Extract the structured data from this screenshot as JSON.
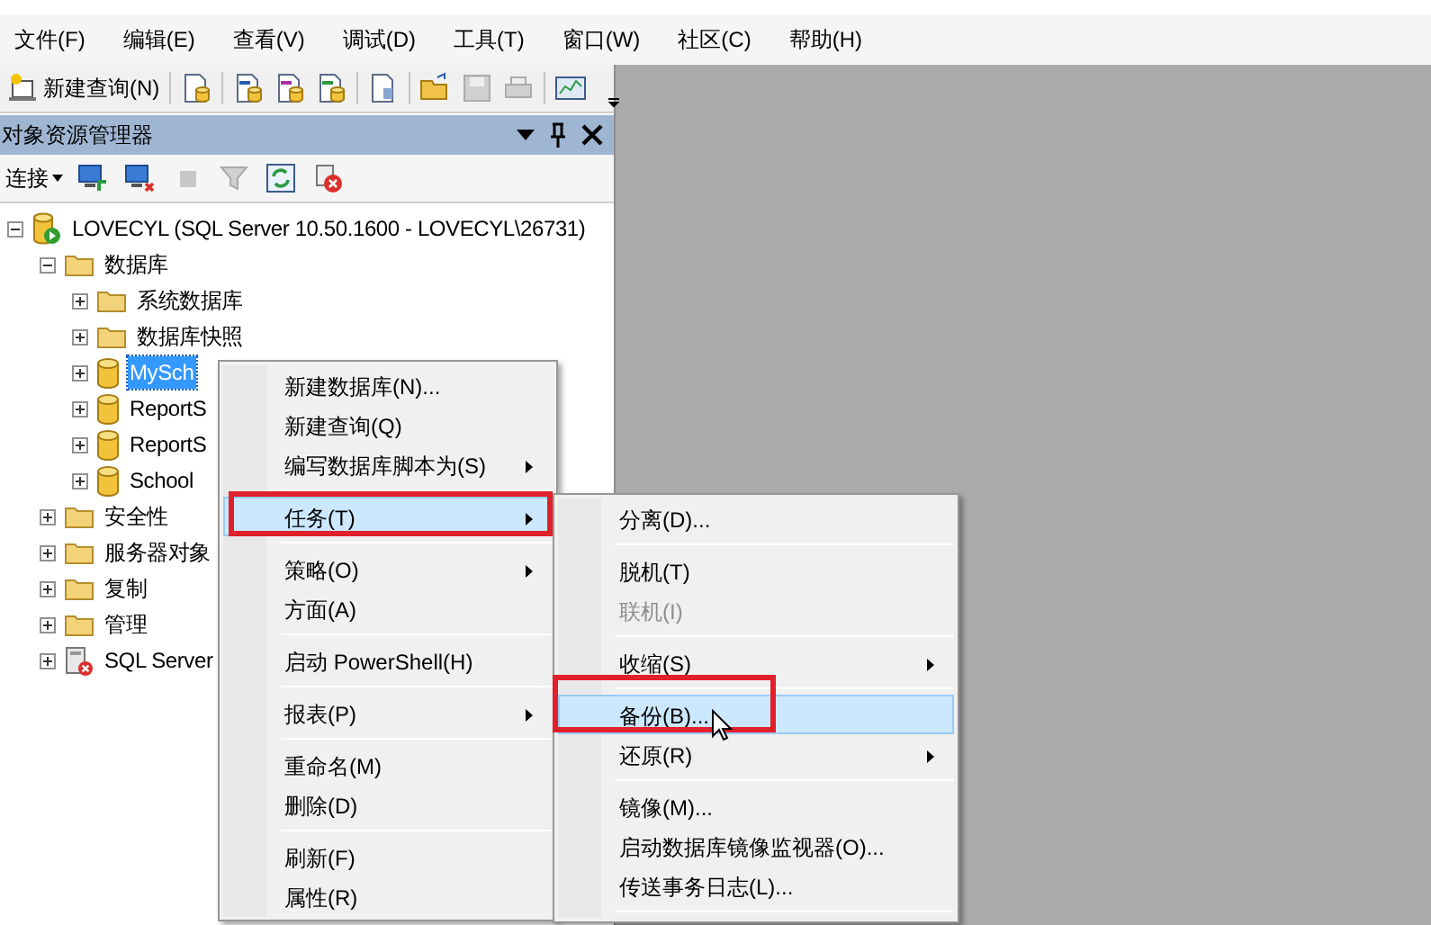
{
  "menu_bar": [
    "文件(F)",
    "编辑(E)",
    "查看(V)",
    "调试(D)",
    "工具(T)",
    "窗口(W)",
    "社区(C)",
    "帮助(H)"
  ],
  "toolbar": {
    "new_query": "新建查询(N)"
  },
  "object_explorer": {
    "title": "对象资源管理器",
    "connect": "连接",
    "tree": [
      {
        "label": "LOVECYL (SQL Server 10.50.1600 - LOVECYL\\26731)",
        "kind": "server",
        "expanded": true,
        "selected": false,
        "children": [
          {
            "label": "数据库",
            "kind": "folder",
            "expanded": true,
            "selected": false,
            "children": [
              {
                "label": "系统数据库",
                "kind": "folder",
                "expanded": false,
                "selected": false
              },
              {
                "label": "数据库快照",
                "kind": "folder",
                "expanded": false,
                "selected": false
              },
              {
                "label": "MySch",
                "kind": "database",
                "expanded": false,
                "selected": true
              },
              {
                "label": "ReportS",
                "kind": "database",
                "expanded": false,
                "selected": false
              },
              {
                "label": "ReportS",
                "kind": "database",
                "expanded": false,
                "selected": false
              },
              {
                "label": "School",
                "kind": "database",
                "expanded": false,
                "selected": false
              }
            ]
          },
          {
            "label": "安全性",
            "kind": "folder",
            "expanded": false,
            "selected": false
          },
          {
            "label": "服务器对象",
            "kind": "folder",
            "expanded": false,
            "selected": false
          },
          {
            "label": "复制",
            "kind": "folder",
            "expanded": false,
            "selected": false
          },
          {
            "label": "管理",
            "kind": "folder",
            "expanded": false,
            "selected": false
          },
          {
            "label": "SQL Server",
            "kind": "agent",
            "expanded": false,
            "selected": false
          }
        ]
      }
    ]
  },
  "context_menu": [
    {
      "kind": "item",
      "label": "新建数据库(N)...",
      "submenu": false,
      "selected": false,
      "disabled": false
    },
    {
      "kind": "item",
      "label": "新建查询(Q)",
      "submenu": false,
      "selected": false,
      "disabled": false
    },
    {
      "kind": "item",
      "label": "编写数据库脚本为(S)",
      "submenu": true,
      "selected": false,
      "disabled": false
    },
    {
      "kind": "separator"
    },
    {
      "kind": "item",
      "label": "任务(T)",
      "submenu": true,
      "selected": true,
      "disabled": false
    },
    {
      "kind": "separator"
    },
    {
      "kind": "item",
      "label": "策略(O)",
      "submenu": true,
      "selected": false,
      "disabled": false
    },
    {
      "kind": "item",
      "label": "方面(A)",
      "submenu": false,
      "selected": false,
      "disabled": false
    },
    {
      "kind": "separator"
    },
    {
      "kind": "item",
      "label": "启动 PowerShell(H)",
      "submenu": false,
      "selected": false,
      "disabled": false
    },
    {
      "kind": "separator"
    },
    {
      "kind": "item",
      "label": "报表(P)",
      "submenu": true,
      "selected": false,
      "disabled": false
    },
    {
      "kind": "separator"
    },
    {
      "kind": "item",
      "label": "重命名(M)",
      "submenu": false,
      "selected": false,
      "disabled": false
    },
    {
      "kind": "item",
      "label": "删除(D)",
      "submenu": false,
      "selected": false,
      "disabled": false
    },
    {
      "kind": "separator"
    },
    {
      "kind": "item",
      "label": "刷新(F)",
      "submenu": false,
      "selected": false,
      "disabled": false
    },
    {
      "kind": "item",
      "label": "属性(R)",
      "submenu": false,
      "selected": false,
      "disabled": false
    }
  ],
  "tasks_submenu": [
    {
      "kind": "item",
      "label": "分离(D)...",
      "submenu": false,
      "selected": false,
      "disabled": false
    },
    {
      "kind": "separator"
    },
    {
      "kind": "item",
      "label": "脱机(T)",
      "submenu": false,
      "selected": false,
      "disabled": false
    },
    {
      "kind": "item",
      "label": "联机(I)",
      "submenu": false,
      "selected": false,
      "disabled": true
    },
    {
      "kind": "separator"
    },
    {
      "kind": "item",
      "label": "收缩(S)",
      "submenu": true,
      "selected": false,
      "disabled": false
    },
    {
      "kind": "separator"
    },
    {
      "kind": "item",
      "label": "备份(B)...",
      "submenu": false,
      "selected": true,
      "disabled": false
    },
    {
      "kind": "item",
      "label": "还原(R)",
      "submenu": true,
      "selected": false,
      "disabled": false
    },
    {
      "kind": "separator"
    },
    {
      "kind": "item",
      "label": "镜像(M)...",
      "submenu": false,
      "selected": false,
      "disabled": false
    },
    {
      "kind": "item",
      "label": "启动数据库镜像监视器(O)...",
      "submenu": false,
      "selected": false,
      "disabled": false
    },
    {
      "kind": "item",
      "label": "传送事务日志(L)...",
      "submenu": false,
      "selected": false,
      "disabled": false
    },
    {
      "kind": "separator"
    }
  ]
}
